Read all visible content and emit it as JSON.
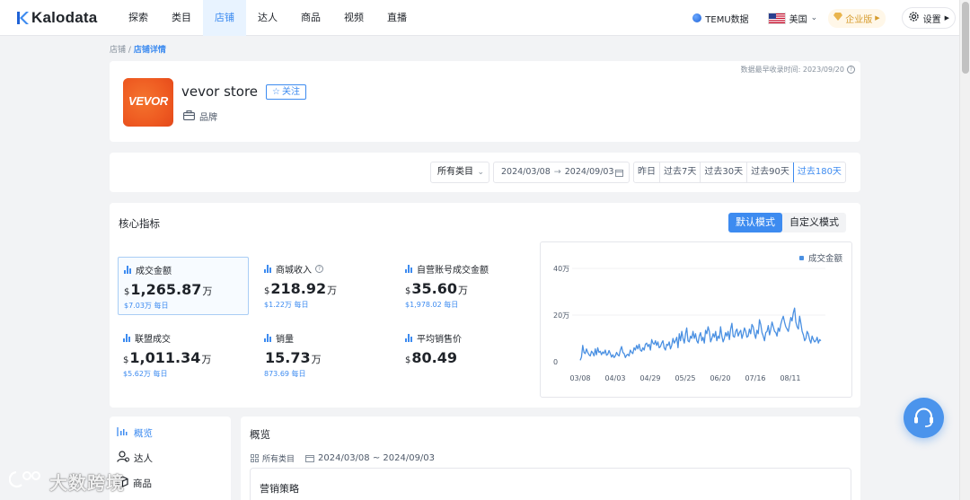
{
  "app": {
    "logo_text": "Kalodata"
  },
  "nav": {
    "items": [
      {
        "label": "探索"
      },
      {
        "label": "类目"
      },
      {
        "label": "店铺"
      },
      {
        "label": "达人"
      },
      {
        "label": "商品"
      },
      {
        "label": "视频"
      },
      {
        "label": "直播"
      }
    ],
    "active_index": 2,
    "temu_label": "TEMU数据",
    "region_label": "美国",
    "enterprise_label": "企业版",
    "settings_label": "设置"
  },
  "breadcrumb": {
    "parent": "店铺",
    "separator": "/",
    "current": "店铺详情"
  },
  "store": {
    "name": "vevor store",
    "logo_text": "VEVOR",
    "follow_label": "关注",
    "type_label": "品牌",
    "data_time": "数据最早收录时间: 2023/09/20"
  },
  "filters": {
    "category": "所有类目",
    "date_start": "2024/03/08",
    "date_arrow": "→",
    "date_end": "2024/09/03",
    "periods": [
      "昨日",
      "过去7天",
      "过去30天",
      "过去90天",
      "过去180天"
    ],
    "active_period": 4
  },
  "metrics": {
    "title": "核心指标",
    "modes": [
      "默认模式",
      "自定义模式"
    ],
    "items": [
      {
        "label": "成交金额",
        "currency": "$",
        "value": "1,265.87",
        "unit": "万",
        "sub": "$7.03万 每日",
        "selected": true
      },
      {
        "label": "商城收入",
        "currency": "$",
        "value": "218.92",
        "unit": "万",
        "sub": "$1.22万 每日",
        "info": true
      },
      {
        "label": "自营账号成交金额",
        "currency": "$",
        "value": "35.60",
        "unit": "万",
        "sub": "$1,978.02 每日"
      },
      {
        "label": "联盟成交",
        "currency": "$",
        "value": "1,011.34",
        "unit": "万",
        "sub": "$5.62万 每日"
      },
      {
        "label": "销量",
        "currency": "",
        "value": "15.73",
        "unit": "万",
        "sub": "873.69 每日"
      },
      {
        "label": "平均销售价",
        "currency": "$",
        "value": "80.49",
        "unit": "",
        "sub": ""
      }
    ]
  },
  "chart_data": {
    "type": "line",
    "series": [
      {
        "name": "成交金额",
        "color": "#4a90e2",
        "values": [
          0.6,
          2,
          7,
          4,
          3.5,
          5.5,
          4,
          3,
          2.5,
          4.5,
          3.8,
          2.5,
          5.5,
          3,
          6,
          4,
          4.5,
          3,
          4.2,
          3.5,
          5,
          2.8,
          3.2,
          4.8,
          3.5,
          2,
          3,
          1.8,
          2.5,
          4,
          3,
          2.5,
          5,
          6.5,
          4,
          3.5,
          1.8,
          2.8,
          3.2,
          2.5,
          5,
          4,
          3.5,
          6,
          5,
          7,
          5.5,
          7.5,
          5,
          4.5,
          6,
          5,
          7.5,
          8,
          6.5,
          7.5,
          5,
          9.5,
          8,
          7.5,
          9,
          7,
          8.5,
          6,
          6.5,
          8,
          9,
          6,
          5,
          7.5,
          7,
          8.5,
          5.5,
          7,
          10,
          8,
          9,
          10.5,
          6,
          12,
          9,
          13,
          10,
          8,
          12,
          14.5,
          9,
          8.5,
          11,
          10,
          13,
          10,
          12,
          9,
          8,
          11,
          12.5,
          9,
          10.5,
          8,
          13.5,
          12,
          15,
          13,
          8.5,
          10,
          12,
          10.5,
          13,
          9,
          11,
          10,
          15,
          11,
          8.5,
          10,
          12.5,
          11,
          13,
          9.5,
          14,
          16.5,
          11,
          10.5,
          13,
          14,
          11,
          12.5,
          13.5,
          10,
          12,
          14.5,
          13,
          10.5,
          11,
          14,
          12,
          16,
          15,
          12,
          10,
          13.5,
          12,
          18,
          16,
          12.5,
          11,
          9,
          12.5,
          13,
          15.5,
          11.5,
          14,
          17,
          15,
          13,
          12.5,
          11,
          14.5,
          13,
          16,
          18,
          19.5,
          17,
          15,
          14,
          13,
          16,
          19,
          17.5,
          21,
          23,
          17,
          15,
          14,
          19.5,
          16.5,
          13,
          11.5,
          9,
          10,
          13,
          12,
          9.5,
          8,
          11,
          9.5,
          8.5,
          9,
          10.5,
          8,
          9.5,
          9
        ]
      }
    ],
    "categories": [
      "03/08",
      "04/03",
      "04/29",
      "05/25",
      "06/20",
      "07/16",
      "08/11"
    ],
    "y_ticks": [
      "40万",
      "20万",
      "0"
    ],
    "ylim": [
      0,
      40
    ],
    "legend_position": "top-right",
    "grid": true
  },
  "sidebar": {
    "items": [
      {
        "label": "概览",
        "active": true
      },
      {
        "label": "达人"
      },
      {
        "label": "商品"
      }
    ]
  },
  "overview": {
    "title": "概览",
    "category": "所有类目",
    "date_range": "2024/03/08 ~ 2024/09/03",
    "strategy_title": "营销策略"
  },
  "watermark": {
    "text": "大数跨境"
  }
}
